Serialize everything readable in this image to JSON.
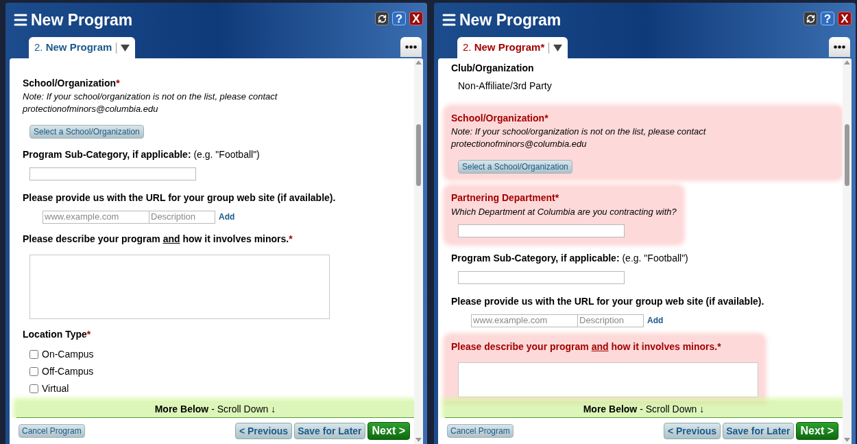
{
  "windows": [
    {
      "title": "New Program",
      "controls": [
        {
          "kind": "refresh"
        },
        {
          "kind": "help",
          "glyph": "?"
        },
        {
          "kind": "close",
          "glyph": "X"
        }
      ],
      "tab": {
        "number": "2.",
        "label": "New Program",
        "invalid": false,
        "selected": true
      },
      "fields": [
        {
          "kind": "select",
          "label": "School/Organization",
          "mark": "*",
          "error": false,
          "note": "Note: If your school/organization is not on the list, please contact protectionofminors@columbia.edu",
          "button": "Select a School/Organization"
        },
        {
          "kind": "text",
          "label": "**Program Sub-Category, if applicable:** (e.g. \"Football\")",
          "error": false
        },
        {
          "kind": "url",
          "label": "Please provide us with the URL for your group web site (if available).",
          "error": false,
          "url_placeholder": "www.example.com",
          "desc_placeholder": "Description",
          "add": "Add"
        },
        {
          "kind": "textarea",
          "label_parts": [
            {
              "text": "Please describe your program ",
              "underline": false
            },
            {
              "text": "and",
              "underline": true
            },
            {
              "text": " how it involves minors.",
              "underline": false
            }
          ],
          "mark": "*",
          "error": false
        },
        {
          "kind": "checkboxes",
          "label": "Location Type",
          "mark": "*",
          "error": false,
          "options": [
            {
              "label": "On-Campus",
              "checked": false
            },
            {
              "label": "Off-Campus",
              "checked": false
            },
            {
              "label": "Virtual",
              "checked": false
            }
          ]
        }
      ],
      "more_below": "**More Below** - Scroll Down ↓",
      "cancel": "Cancel Program",
      "previous": "< Previous",
      "save": "Save for Later",
      "next": "Next >"
    },
    {
      "title": "New Program",
      "controls": [
        {
          "kind": "refresh"
        },
        {
          "kind": "help",
          "glyph": "?"
        },
        {
          "kind": "close",
          "glyph": "X"
        }
      ],
      "tab": {
        "number": "2.",
        "label": "New Program*",
        "invalid": true,
        "selected": true
      },
      "fields": [
        {
          "kind": "static",
          "label": "Club/Organization",
          "value": "Non-Affiliate/3rd Party",
          "error": false
        },
        {
          "kind": "select",
          "label": "School/Organization",
          "mark": "*",
          "error": true,
          "note": "Note: If your school/organization is not on the list, please contact protectionofminors@columbia.edu",
          "button": "Select a School/Organization"
        },
        {
          "kind": "text",
          "label": "Partnering Department",
          "mark": "*",
          "error": true,
          "note": "Which Department at Columbia are you contracting with?"
        },
        {
          "kind": "text",
          "label": "**Program Sub-Category, if applicable:** (e.g. \"Football\")",
          "error": false
        },
        {
          "kind": "url",
          "label": "Please provide us with the URL for your group web site (if available).",
          "error": false,
          "url_placeholder": "www.example.com",
          "desc_placeholder": "Description",
          "add": "Add"
        },
        {
          "kind": "textarea",
          "label_parts": [
            {
              "text": "Please describe your program ",
              "underline": false
            },
            {
              "text": "and",
              "underline": true
            },
            {
              "text": " how it involves minors.",
              "underline": false
            }
          ],
          "mark": "*",
          "error": true
        }
      ],
      "more_below": "**More Below** - Scroll Down ↓",
      "cancel": "Cancel Program",
      "previous": "< Previous",
      "save": "Save for Later",
      "next": "Next >"
    }
  ]
}
